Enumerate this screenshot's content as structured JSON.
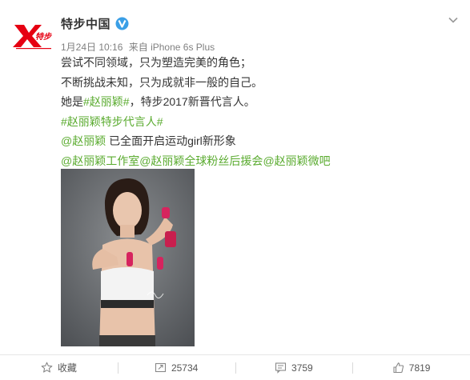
{
  "brand": {
    "logo_text": "特步",
    "accent": "#e60012",
    "verified_color": "#3a9fe6"
  },
  "post": {
    "author": "特步中国",
    "date": "1月24日 10:16",
    "source": "来自 iPhone 6s Plus",
    "lines": {
      "l1": "尝试不同领域，只为塑造完美的角色；",
      "l2": "不断挑战未知，只为成就非一般的自己。",
      "l3_prefix": "她是",
      "l3_topic": "#赵丽颖#",
      "l3_suffix": "，特步2017新晋代言人。",
      "l4_topic": "#赵丽颖特步代言人#",
      "l5_mention": "@赵丽颖",
      "l5_suffix": " 已全面开启运动girl新形象",
      "l6_m1": "@赵丽颖工作室",
      "l6_m2": "@赵丽颖全球粉丝后援会",
      "l6_m3": "@赵丽颖微吧"
    },
    "link_color": "#5aab2f"
  },
  "footer": {
    "favorite_label": "收藏",
    "repost_count": "25734",
    "comment_count": "3759",
    "like_count": "7819"
  },
  "icons": {
    "verified": "verified-badge-icon",
    "chevron": "chevron-down-icon",
    "favorite": "star-icon",
    "repost": "repost-icon",
    "comment": "comment-icon",
    "like": "thumbs-up-icon"
  }
}
